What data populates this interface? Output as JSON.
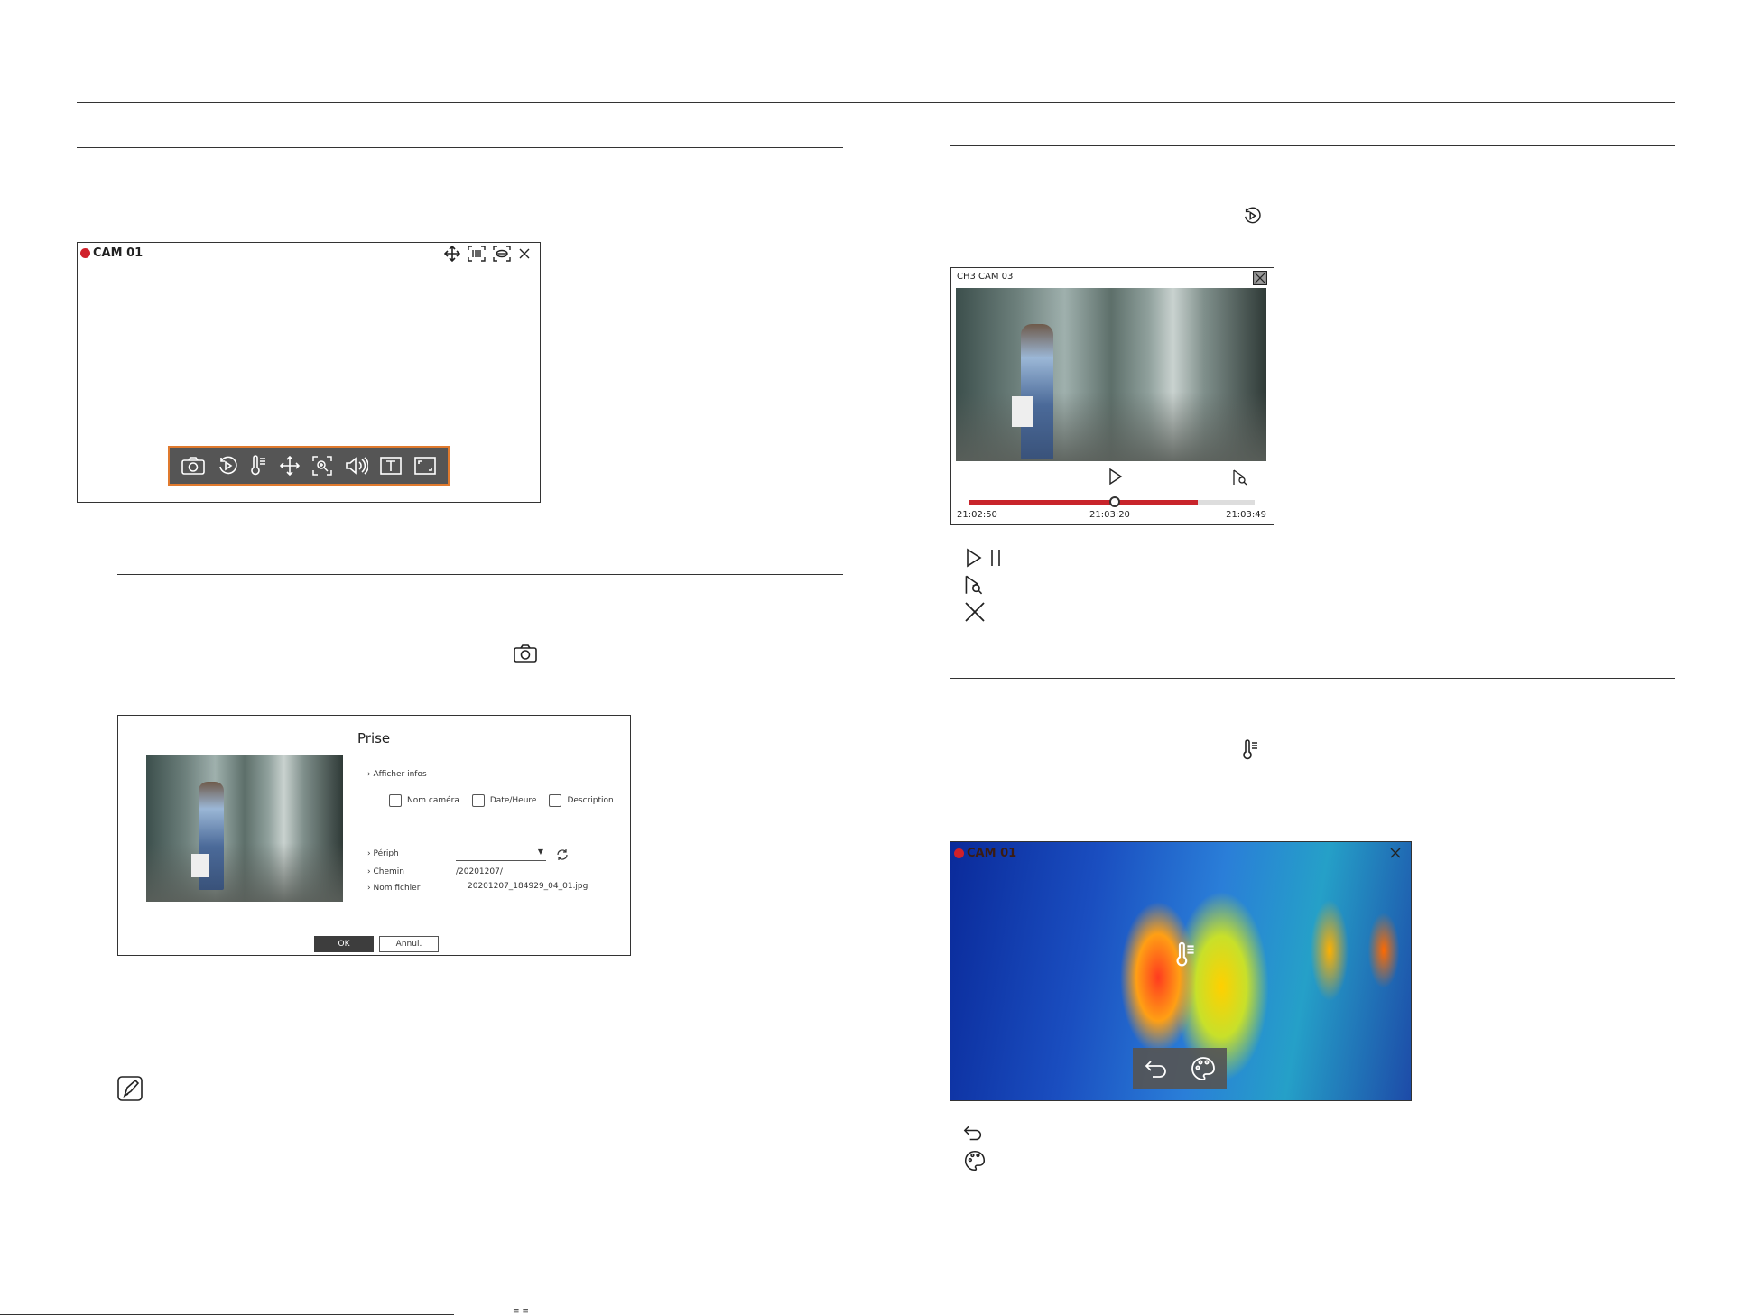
{
  "top_panel": {
    "cam_label": "CAM 01",
    "header_icons": [
      "move-icon",
      "zoom-frame-icon",
      "fisheye-icon",
      "close-icon"
    ],
    "toolbar_icons": [
      "camera-icon",
      "instant-playback-icon",
      "thermometer-icon",
      "ptz-move-icon",
      "digital-zoom-icon",
      "audio-icon",
      "text-icon",
      "fullscreen-icon"
    ]
  },
  "capture_section": {
    "inline_icon": "camera-icon"
  },
  "capture_dialog": {
    "title": "Prise",
    "show_info_label": "Afficher infos",
    "checkboxes": [
      "Nom caméra",
      "Date/Heure",
      "Description"
    ],
    "device_label": "Périph",
    "device_value": "",
    "path_label": "Chemin",
    "path_value": "/20201207/",
    "filename_label": "Nom fichier",
    "filename_value": "20201207_184929_04_01.jpg",
    "ok_label": "OK",
    "cancel_label": "Annul."
  },
  "note": {
    "icon": "note-icon"
  },
  "playback_section": {
    "inline_icon": "instant-playback-icon"
  },
  "playback_panel": {
    "title": "CH3 CAM 03",
    "time_start": "21:02:50",
    "time_current": "21:03:20",
    "time_end": "21:03:49",
    "progress": 0.51,
    "buffered": 0.8
  },
  "playback_legend": [
    "play-pause-icon",
    "search-icon",
    "close-icon"
  ],
  "thermal_section": {
    "inline_icon": "thermometer-icon"
  },
  "thermal_panel": {
    "cam_label": "CAM 01"
  },
  "thermal_legend": [
    "back-icon",
    "palette-icon"
  ],
  "footer": {
    "text": "≡ ≡"
  },
  "colors": {
    "record": "#d0202a",
    "toolbar_border": "#e07a2e",
    "progress": "#c8242b"
  }
}
